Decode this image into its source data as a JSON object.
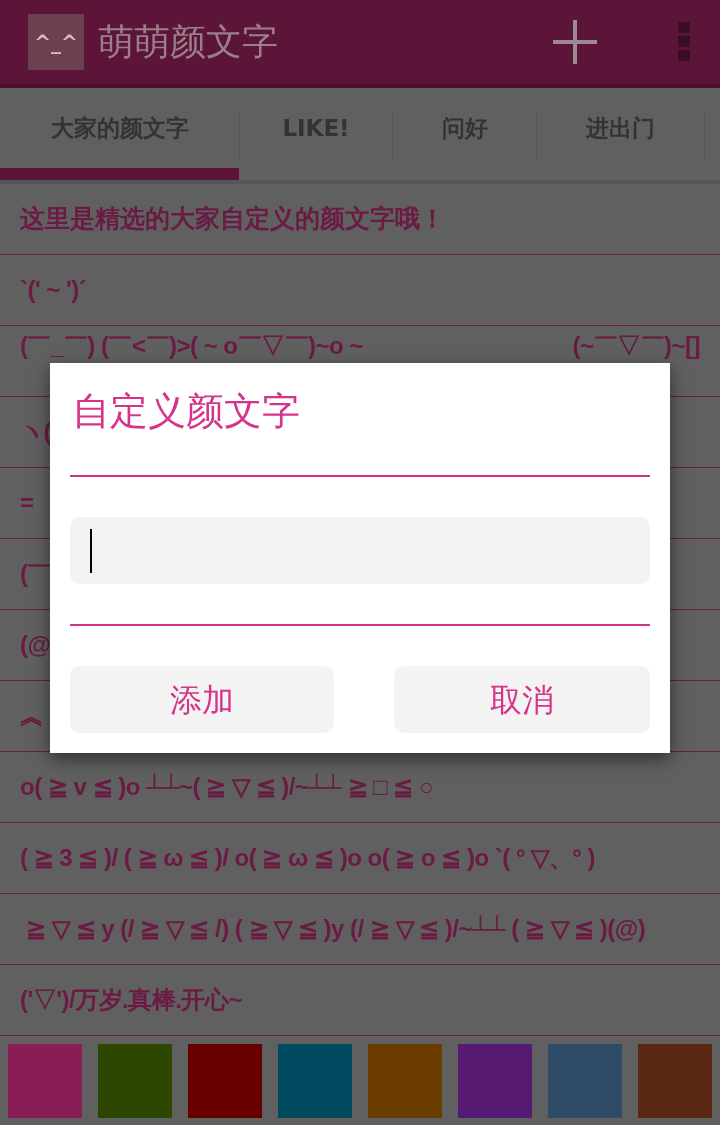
{
  "app_bar": {
    "logo": "^_^",
    "title": "萌萌颜文字"
  },
  "tabs": [
    {
      "label": "大家的颜文字",
      "selected": true
    },
    {
      "label": "LIKE!",
      "selected": false
    },
    {
      "label": "问好",
      "selected": false
    },
    {
      "label": "进出门",
      "selected": false
    }
  ],
  "list": {
    "header": "这里是精选的大家自定义的颜文字哦！",
    "rows": [
      [
        "`(' ~ ')´"
      ],
      [
        "(￣_￣) (￣<￣)>( ~ o￣▽￣)~o ~",
        "(~￣▽￣)~[]"
      ],
      [
        "ヽ("
      ],
      [
        "="
      ],
      [
        "(￣"
      ],
      [
        "(@"
      ],
      [
        "︽"
      ],
      [
        "o( ≧ v ≦ )o ┴┴~( ≧ ▽ ≦ )/~┴┴ ≧ □ ≦ ○"
      ],
      [
        "( ≧ 3 ≦ )/ ( ≧ ω ≦ )/ o( ≧ ω ≦ )o o( ≧ o ≦ )o `( ° ▽、° )"
      ],
      [
        " ≧ ▽ ≦ y (/ ≧ ▽ ≦ /) ( ≧ ▽ ≦ )y (/ ≧ ▽ ≦ )/~┴┴ ( ≧ ▽ ≦ )(@)"
      ],
      [
        "('▽')/万岁.真棒.开心~"
      ]
    ]
  },
  "swatches": [
    {
      "color": "#8a1c56"
    },
    {
      "color": "#2e4700"
    },
    {
      "color": "#690000"
    },
    {
      "color": "#004b60"
    },
    {
      "color": "#6b3c00"
    },
    {
      "color": "#571a72"
    },
    {
      "color": "#2e4b68"
    },
    {
      "color": "#5a2812"
    }
  ],
  "dialog": {
    "title": "自定义颜文字",
    "buttons": [
      "添加",
      "取消"
    ]
  }
}
